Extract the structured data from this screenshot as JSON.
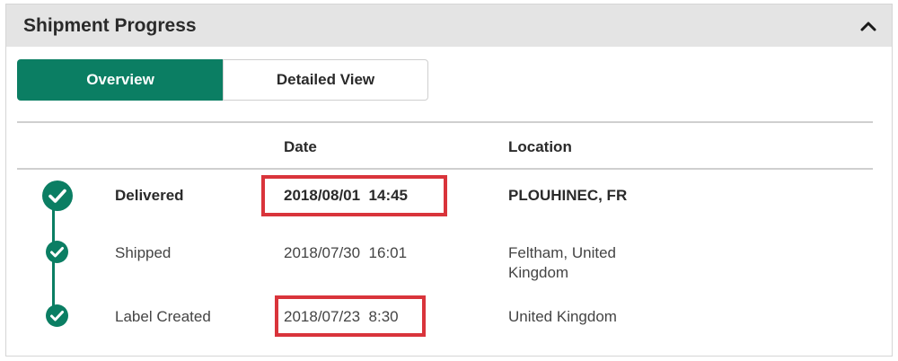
{
  "panel": {
    "title": "Shipment Progress"
  },
  "tabs": [
    {
      "label": "Overview",
      "active": true
    },
    {
      "label": "Detailed View",
      "active": false
    }
  ],
  "table": {
    "columns": {
      "date": "Date",
      "location": "Location"
    },
    "rows": [
      {
        "status": "Delivered",
        "date": "2018/08/01  14:45",
        "location": "PLOUHINEC, FR",
        "bold": true,
        "highlighted": true
      },
      {
        "status": "Shipped",
        "date": "2018/07/30  16:01",
        "location_line1": "Feltham, United",
        "location_line2": "Kingdom",
        "bold": false,
        "highlighted": false
      },
      {
        "status": "Label Created",
        "date": "2018/07/23  8:30",
        "location": "United Kingdom",
        "bold": false,
        "highlighted": true
      }
    ]
  },
  "colors": {
    "accent": "#0b7e63",
    "highlight": "#d9343b",
    "header_bg": "#e4e4e4"
  },
  "icons": {
    "collapse": "chevron-up-icon",
    "step_complete": "check-circle-icon"
  }
}
